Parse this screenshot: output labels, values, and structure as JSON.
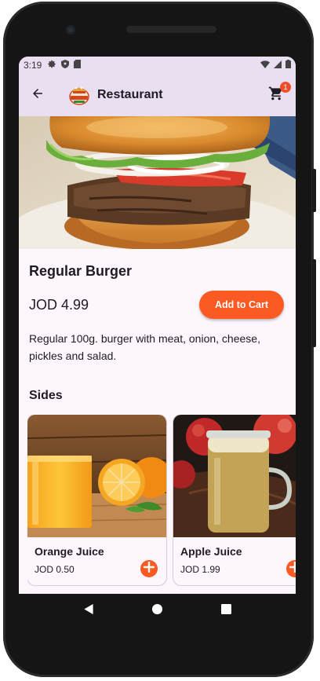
{
  "status_bar": {
    "time": "3:19"
  },
  "app_bar": {
    "title": "Restaurant",
    "cart_count": "1"
  },
  "product": {
    "name": "Regular Burger",
    "price": "JOD 4.99",
    "add_to_cart_label": "Add to Cart",
    "description": "Regular 100g. burger with meat, onion, cheese, pickles and salad."
  },
  "sides": {
    "title": "Sides",
    "items": [
      {
        "name": "Orange Juice",
        "price": "JOD 0.50"
      },
      {
        "name": "Apple Juice",
        "price": "JOD 1.99"
      }
    ]
  },
  "colors": {
    "accent": "#fb5a22",
    "appbar": "#e9dff0",
    "background": "#fdf6fd"
  },
  "icons": [
    "back-arrow-icon",
    "restaurant-logo-icon",
    "cart-icon",
    "settings-icon",
    "shield-icon",
    "sd-card-icon",
    "wifi-icon",
    "signal-icon",
    "battery-icon",
    "plus-icon",
    "nav-back-icon",
    "nav-home-icon",
    "nav-recents-icon"
  ]
}
